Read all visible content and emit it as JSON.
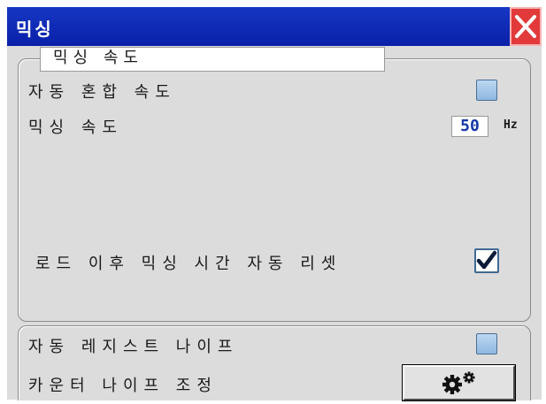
{
  "window": {
    "title": "믹싱",
    "close_icon": "close-icon"
  },
  "main_group": {
    "legend": "믹싱 속도",
    "auto_mix_speed_label": "자동 혼합 속도",
    "auto_mix_speed_checked": false,
    "mixing_speed_label": "믹싱 속도",
    "mixing_speed_value": "50",
    "mixing_speed_unit": "Hz",
    "auto_reset_label": "로드 이후 믹싱 시간 자동 리셋",
    "auto_reset_checked": true
  },
  "bottom_group": {
    "auto_resist_knife_label": "자동 레지스트 나이프",
    "auto_resist_knife_checked": false,
    "counter_knife_label": "카운터 나이프 조정",
    "settings_button_icon": "gears-icon"
  },
  "colors": {
    "titlebar": "#0a20a8",
    "close": "#e23a3a",
    "value_text": "#1438a8",
    "panel": "#dcdcdc"
  }
}
